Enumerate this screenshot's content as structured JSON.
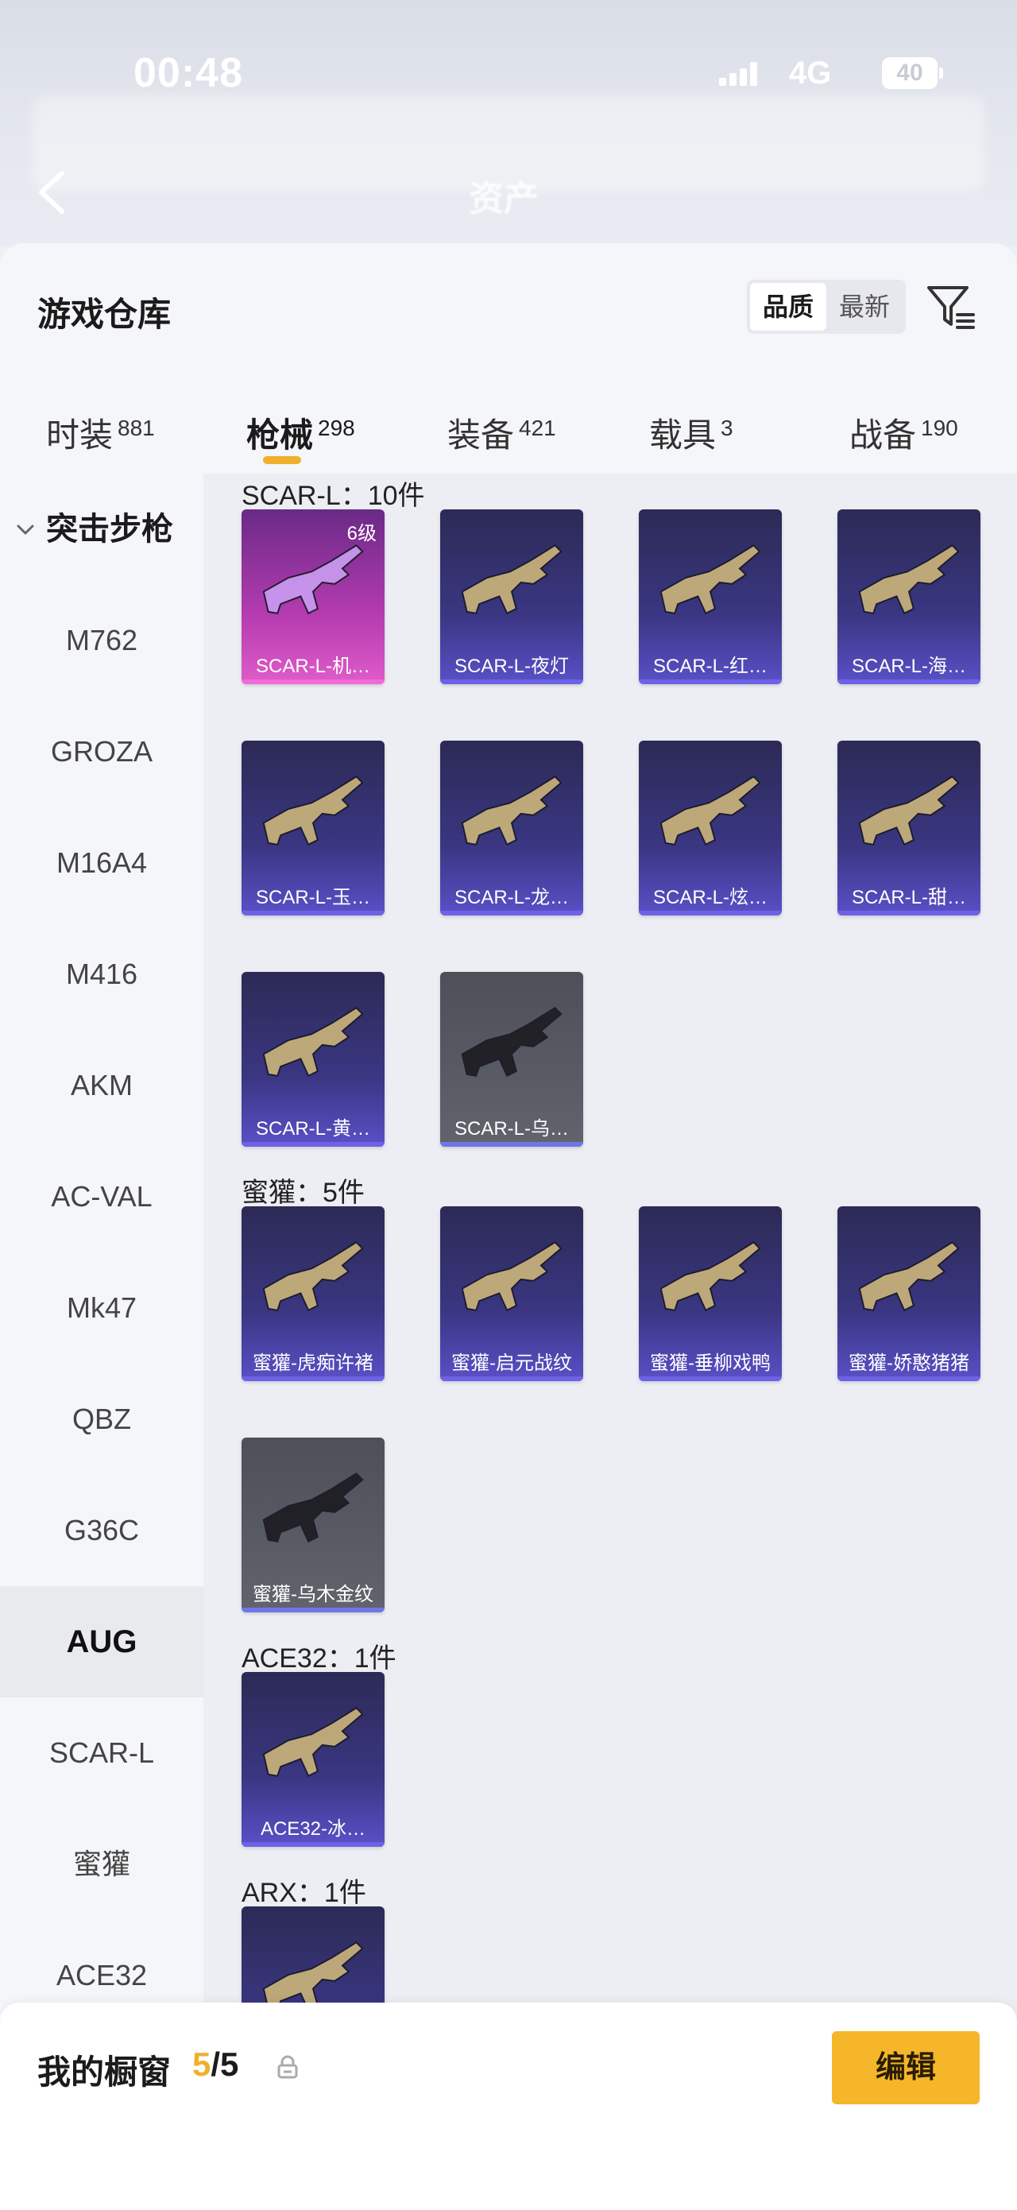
{
  "status_bar": {
    "time": "00:48",
    "network": "4G",
    "battery": "40"
  },
  "header": {
    "title": "资产"
  },
  "sheet": {
    "title": "游戏仓库",
    "sort_options": [
      "品质",
      "最新"
    ],
    "active_sort": "品质"
  },
  "tabs": [
    {
      "label": "时装",
      "count": "881"
    },
    {
      "label": "枪械",
      "count": "298"
    },
    {
      "label": "装备",
      "count": "421"
    },
    {
      "label": "载具",
      "count": "3"
    },
    {
      "label": "战备",
      "count": "190"
    }
  ],
  "sidebar": {
    "group": "突击步枪",
    "items": [
      "M762",
      "GROZA",
      "M16A4",
      "M416",
      "AKM",
      "AC-VAL",
      "Mk47",
      "QBZ",
      "G36C",
      "AUG",
      "SCAR-L",
      "蜜獾",
      "ACE32"
    ],
    "active": "AUG"
  },
  "sections": [
    {
      "label": "SCAR-L：10件",
      "items": [
        {
          "name": "SCAR-L-机…",
          "level": "6级",
          "color": "pink"
        },
        {
          "name": "SCAR-L-夜灯",
          "color": "purple"
        },
        {
          "name": "SCAR-L-红…",
          "color": "purple"
        },
        {
          "name": "SCAR-L-海…",
          "color": "purple"
        },
        {
          "name": "SCAR-L-玉…",
          "color": "purple"
        },
        {
          "name": "SCAR-L-龙…",
          "color": "purple"
        },
        {
          "name": "SCAR-L-炫…",
          "color": "purple"
        },
        {
          "name": "SCAR-L-甜…",
          "color": "purple"
        },
        {
          "name": "SCAR-L-黄…",
          "color": "purple"
        },
        {
          "name": "SCAR-L-乌…",
          "color": "gray"
        }
      ]
    },
    {
      "label": "蜜獾：5件",
      "items": [
        {
          "name": "蜜獾-虎痴许褚",
          "color": "purple"
        },
        {
          "name": "蜜獾-启元战纹",
          "color": "purple"
        },
        {
          "name": "蜜獾-垂柳戏鸭",
          "color": "purple"
        },
        {
          "name": "蜜獾-娇憨猪猪",
          "color": "purple"
        },
        {
          "name": "蜜獾-乌木金纹",
          "color": "gray"
        }
      ]
    },
    {
      "label": "ACE32：1件",
      "items": [
        {
          "name": "ACE32-冰…",
          "color": "purple"
        }
      ]
    },
    {
      "label": "ARX：1件",
      "items": [
        {
          "name": "",
          "color": "purple"
        }
      ]
    }
  ],
  "showcase": {
    "title": "我的橱窗",
    "current": "5",
    "total": "/5",
    "edit_label": "编辑"
  },
  "colors": {
    "accent": "#f5b62a",
    "purple_card": "#3a3682",
    "pink_card": "#b43bb0",
    "gray_card": "#585a64"
  }
}
